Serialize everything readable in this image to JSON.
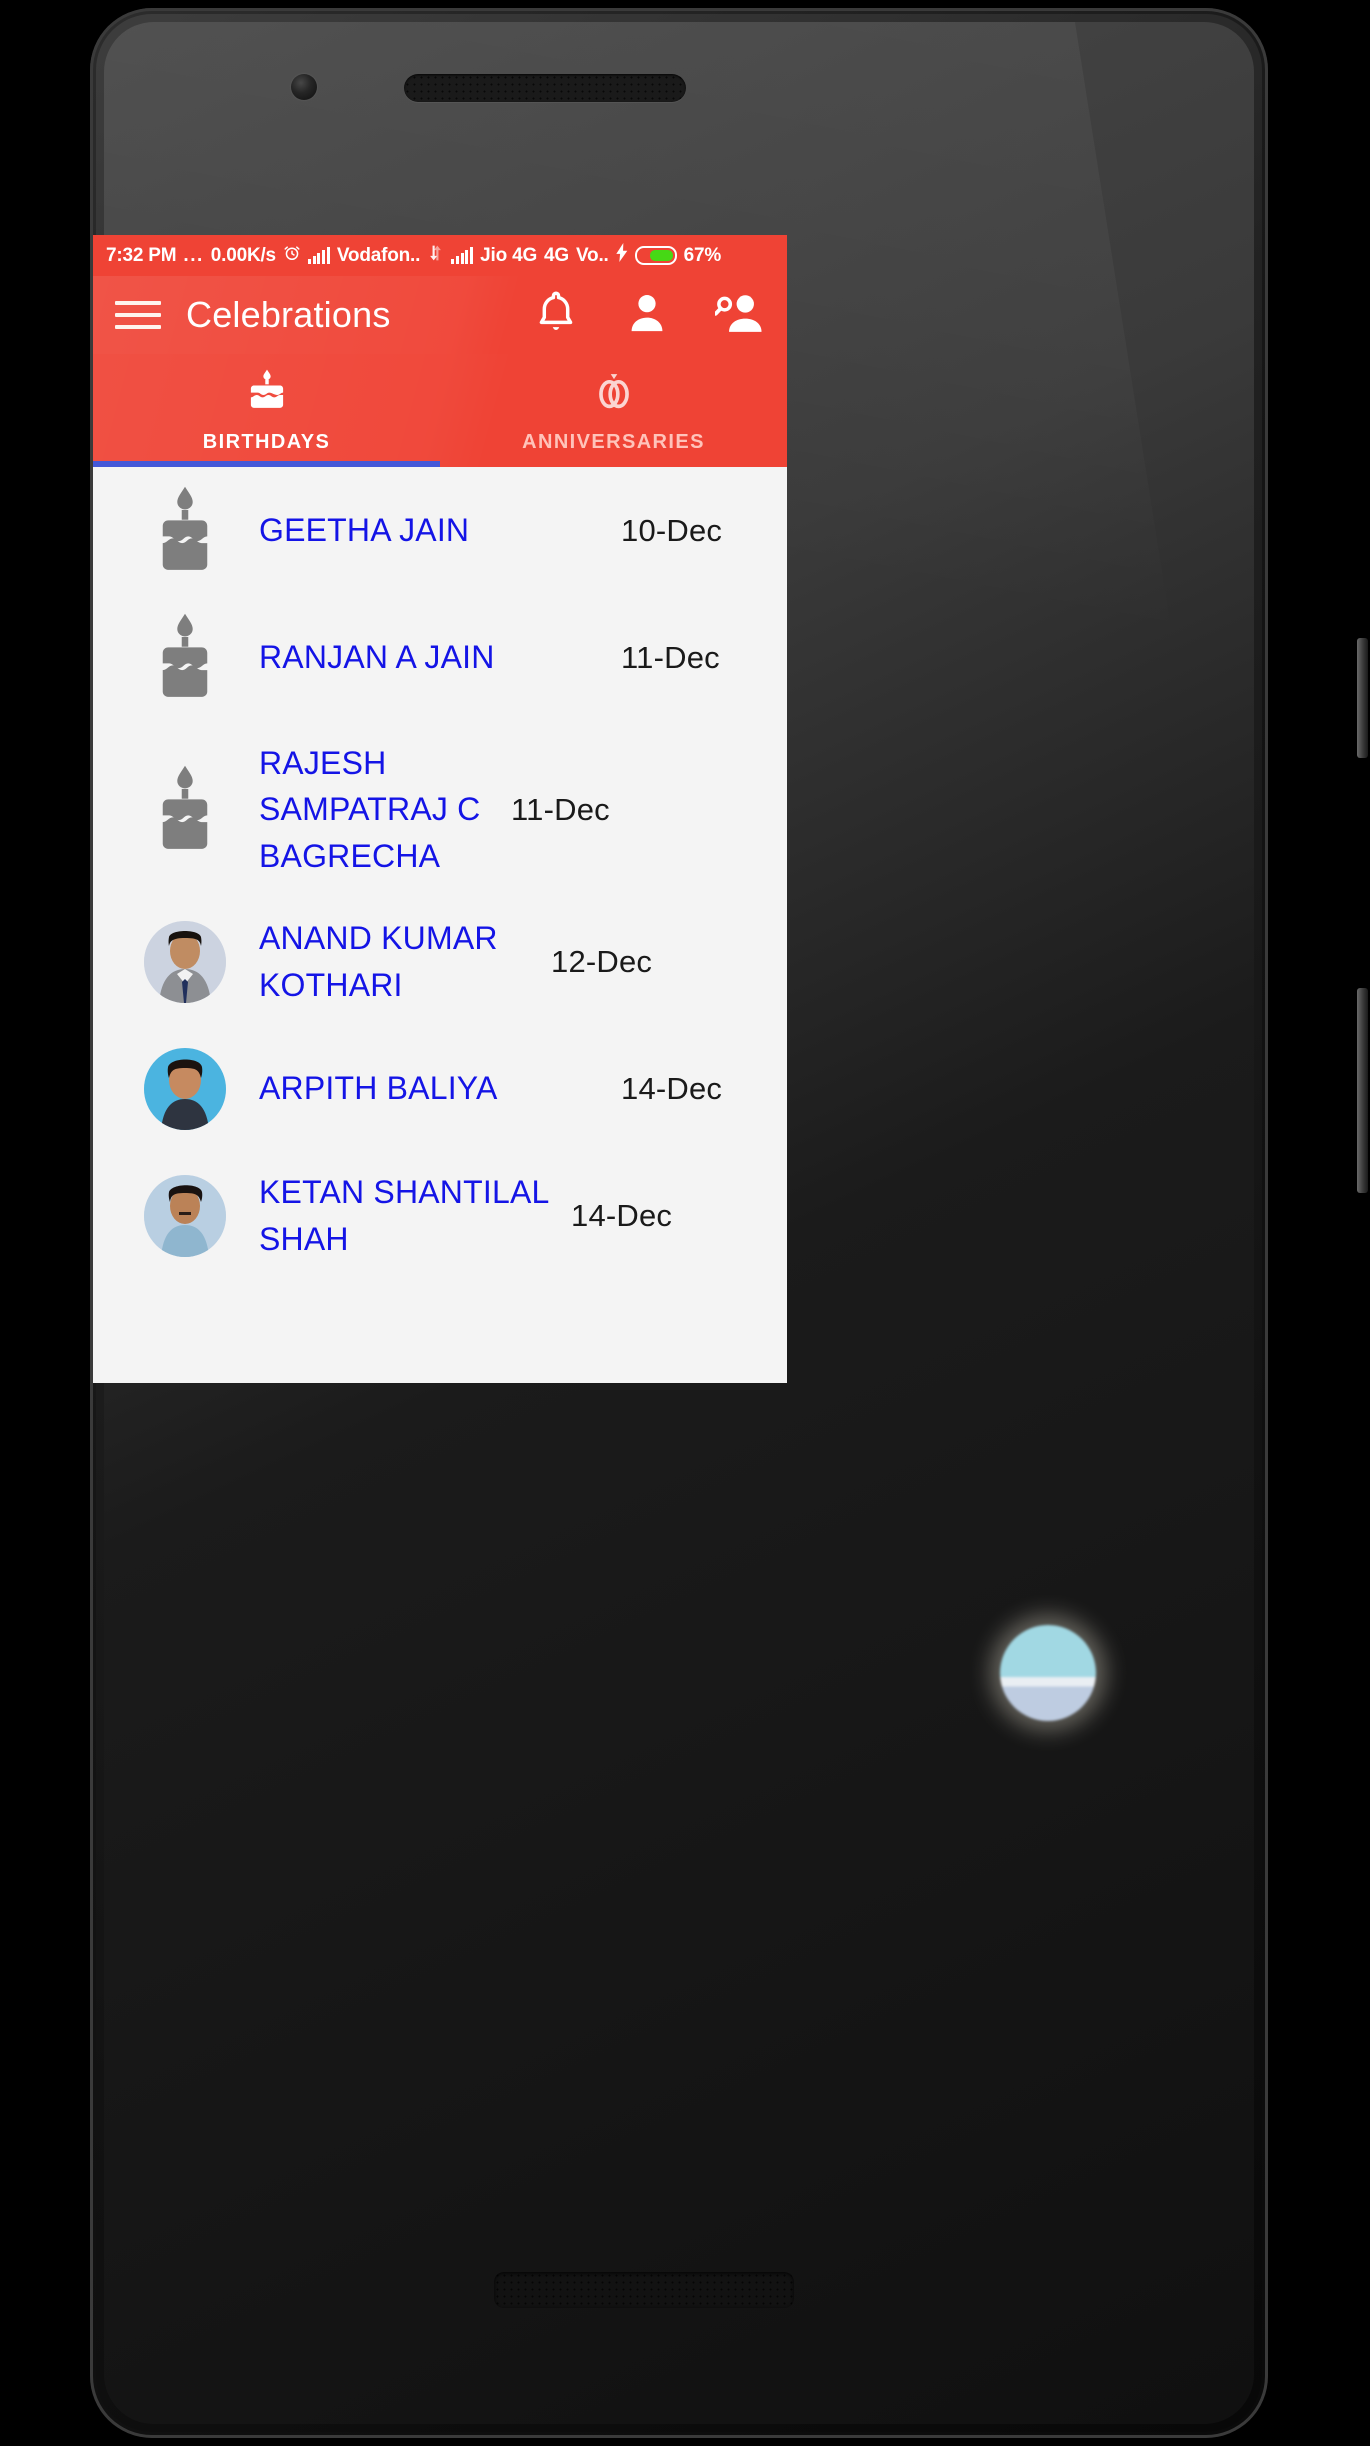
{
  "status_bar": {
    "time": "7:32 PM",
    "overflow_dots": "...",
    "net_speed": "0.00K/s",
    "alarm_icon": "alarm-clock-icon",
    "sim1_signal_icon": "signal-bars-icon",
    "carrier_1": "Vodafon..",
    "data_transfer_icon": "data-transfer-icon",
    "sim2_signal_icon": "signal-bars-icon",
    "carrier_2": "Jio 4G",
    "network_type": "4G",
    "volte": "Vo..",
    "charging_icon": "charging-bolt-icon",
    "battery_icon": "battery-icon",
    "battery_percent": "67%",
    "battery_level": 67
  },
  "app_bar": {
    "menu_icon": "hamburger-menu-icon",
    "title": "Celebrations",
    "actions": [
      {
        "name": "notifications-bell-icon",
        "label": "Notifications"
      },
      {
        "name": "account-person-icon",
        "label": "Profile"
      },
      {
        "name": "person-search-icon",
        "label": "Find People"
      }
    ]
  },
  "tabs": {
    "active_index": 0,
    "items": [
      {
        "label": "BIRTHDAYS",
        "icon": "birthday-cake-icon"
      },
      {
        "label": "ANNIVERSARIES",
        "icon": "wedding-rings-icon"
      }
    ]
  },
  "list": {
    "rows": [
      {
        "name": "GEETHA JAIN",
        "date": "10-Dec",
        "avatar": "cake",
        "photo": null
      },
      {
        "name": "RANJAN A JAIN",
        "date": "11-Dec",
        "avatar": "cake",
        "photo": null
      },
      {
        "name": "RAJESH SAMPATRAJ C BAGRECHA",
        "date": "11-Dec",
        "avatar": "cake",
        "photo": null
      },
      {
        "name": "ANAND KUMAR KOTHARI",
        "date": "12-Dec",
        "avatar": "photo",
        "photo": "man-in-suit-with-tie"
      },
      {
        "name": "ARPITH  BALIYA",
        "date": "14-Dec",
        "avatar": "photo",
        "photo": "young-man-blue-background"
      },
      {
        "name": "KETAN SHANTILAL SHAH",
        "date": "14-Dec",
        "avatar": "photo",
        "photo": "man-with-moustache-blue-shirt"
      }
    ]
  },
  "colors": {
    "accent_red": "#ef4335",
    "tab_indicator_blue": "#4458d8",
    "name_blue": "#1414e6",
    "list_background": "#f4f4f4",
    "battery_green": "#46d815",
    "cake_gray": "#7e7e7e"
  },
  "decorations": {
    "floating_bubble": "floating-bubble-overlay"
  }
}
